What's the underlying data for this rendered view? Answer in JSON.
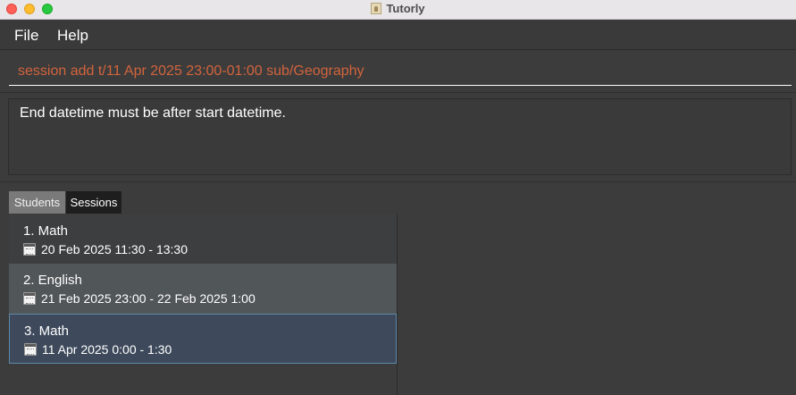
{
  "window": {
    "title": "Tutorly",
    "icon": "app-icon"
  },
  "menu": {
    "items": [
      "File",
      "Help"
    ]
  },
  "command": {
    "value": "session add t/11 Apr 2025 23:00-01:00 sub/Geography",
    "color": "#d2643c"
  },
  "result": {
    "message": "End datetime must be after start datetime."
  },
  "tabs": [
    {
      "label": "Students",
      "active": false
    },
    {
      "label": "Sessions",
      "active": true
    }
  ],
  "sessions": [
    {
      "title": "1. Math",
      "datetime": "20 Feb 2025 11:30 - 13:30",
      "icon": "calendar-icon"
    },
    {
      "title": "2. English",
      "datetime": "21 Feb 2025 23:00 - 22 Feb 2025 1:00",
      "icon": "calendar-icon"
    },
    {
      "title": "3. Math",
      "datetime": "11 Apr 2025 0:00 - 1:30",
      "icon": "calendar-icon"
    }
  ]
}
